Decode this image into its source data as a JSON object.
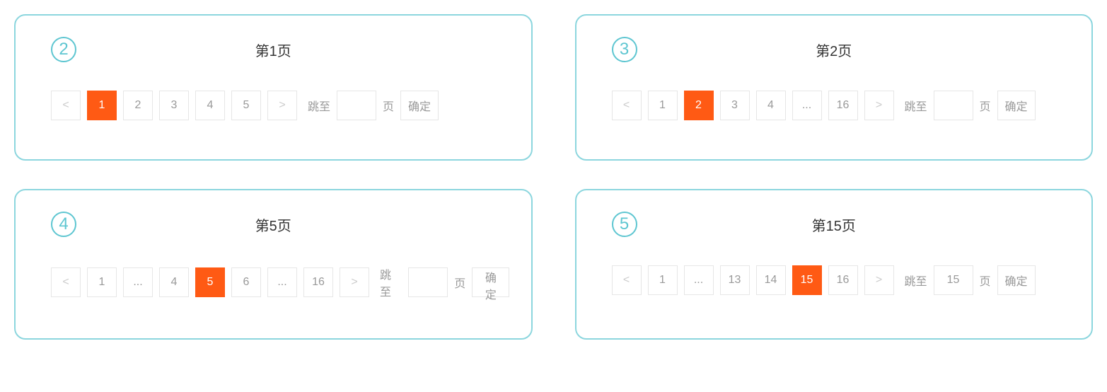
{
  "labels": {
    "jump_to": "跳至",
    "page_suffix": "页",
    "confirm": "确定",
    "prev": "<",
    "next": ">"
  },
  "panels": [
    {
      "badge": "2",
      "title": "第1页",
      "pages": [
        {
          "label": "1",
          "active": true
        },
        {
          "label": "2",
          "active": false
        },
        {
          "label": "3",
          "active": false
        },
        {
          "label": "4",
          "active": false
        },
        {
          "label": "5",
          "active": false
        }
      ],
      "jump_value": ""
    },
    {
      "badge": "3",
      "title": "第2页",
      "pages": [
        {
          "label": "1",
          "active": false
        },
        {
          "label": "2",
          "active": true
        },
        {
          "label": "3",
          "active": false
        },
        {
          "label": "4",
          "active": false
        },
        {
          "label": "...",
          "active": false
        },
        {
          "label": "16",
          "active": false
        }
      ],
      "jump_value": ""
    },
    {
      "badge": "4",
      "title": "第5页",
      "pages": [
        {
          "label": "1",
          "active": false
        },
        {
          "label": "...",
          "active": false
        },
        {
          "label": "4",
          "active": false
        },
        {
          "label": "5",
          "active": true
        },
        {
          "label": "6",
          "active": false
        },
        {
          "label": "...",
          "active": false
        },
        {
          "label": "16",
          "active": false
        }
      ],
      "jump_value": ""
    },
    {
      "badge": "5",
      "title": "第15页",
      "pages": [
        {
          "label": "1",
          "active": false
        },
        {
          "label": "...",
          "active": false
        },
        {
          "label": "13",
          "active": false
        },
        {
          "label": "14",
          "active": false
        },
        {
          "label": "15",
          "active": true
        },
        {
          "label": "16",
          "active": false
        }
      ],
      "jump_value": "15"
    }
  ]
}
